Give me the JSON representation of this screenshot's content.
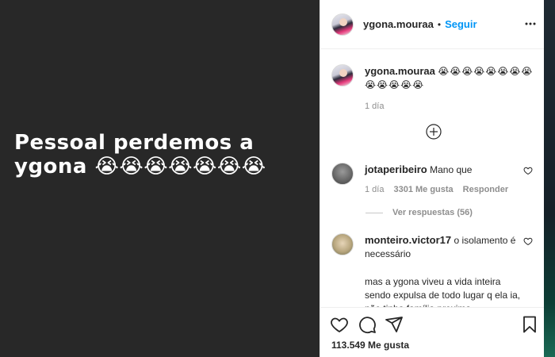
{
  "media": {
    "line1": "Pessoal perdemos a",
    "line2": "ygona 😭😭😭😭😭😭😭"
  },
  "header": {
    "username": "ygona.mouraa",
    "separator": "•",
    "follow_label": "Seguir",
    "more_icon": "more-horizontal-icon"
  },
  "caption": {
    "username": "ygona.mouraa",
    "text": "😭😭😭😭😭😭😭😭😭😭😭😭😭",
    "time": "1 día"
  },
  "load_more_icon": "plus-circle-icon",
  "comments": [
    {
      "username": "jotaperibeiro",
      "text": "Mano que",
      "time": "1 día",
      "likes": "3301 Me gusta",
      "reply": "Responder",
      "view_replies": "Ver respuestas (56)"
    },
    {
      "username": "monteiro.victor17",
      "text": "o isolamento é necessário",
      "text2": "mas a ygona viveu a vida inteira sendo expulsa de todo lugar q ela ia, não tinha família proxima"
    }
  ],
  "actions": {
    "like_icon": "heart-icon",
    "comment_icon": "comment-icon",
    "share_icon": "share-icon",
    "save_icon": "bookmark-icon",
    "likes_count": "113.549 Me gusta"
  },
  "colors": {
    "accent": "#0095f6",
    "media_bg": "#282828",
    "muted": "#8e8e8e"
  }
}
